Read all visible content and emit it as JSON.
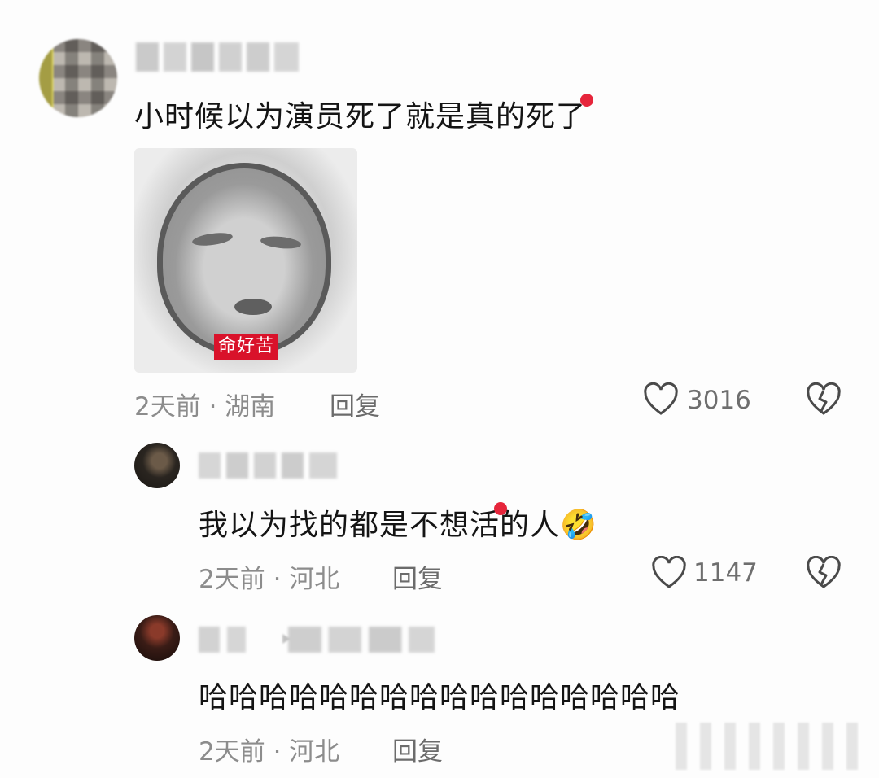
{
  "comments": [
    {
      "text": "小时候以为演员死了就是真的死了",
      "sticker_label": "命好苦",
      "meta": "2天前 · 湖南",
      "reply_label": "回复",
      "likes": "3016"
    },
    {
      "text": "我以为找的都是不想活的人",
      "emoji": "🤣",
      "meta": "2天前 · 河北",
      "reply_label": "回复",
      "likes": "1147"
    },
    {
      "text": "哈哈哈哈哈哈哈哈哈哈哈哈哈哈哈哈",
      "meta": "2天前 · 河北",
      "reply_label": "回复"
    }
  ],
  "colors": {
    "accent_dot": "#e6253b",
    "sticker_label_bg": "#d9122a"
  },
  "icons": {
    "like": "heart-outline-icon",
    "dislike": "broken-heart-icon"
  }
}
